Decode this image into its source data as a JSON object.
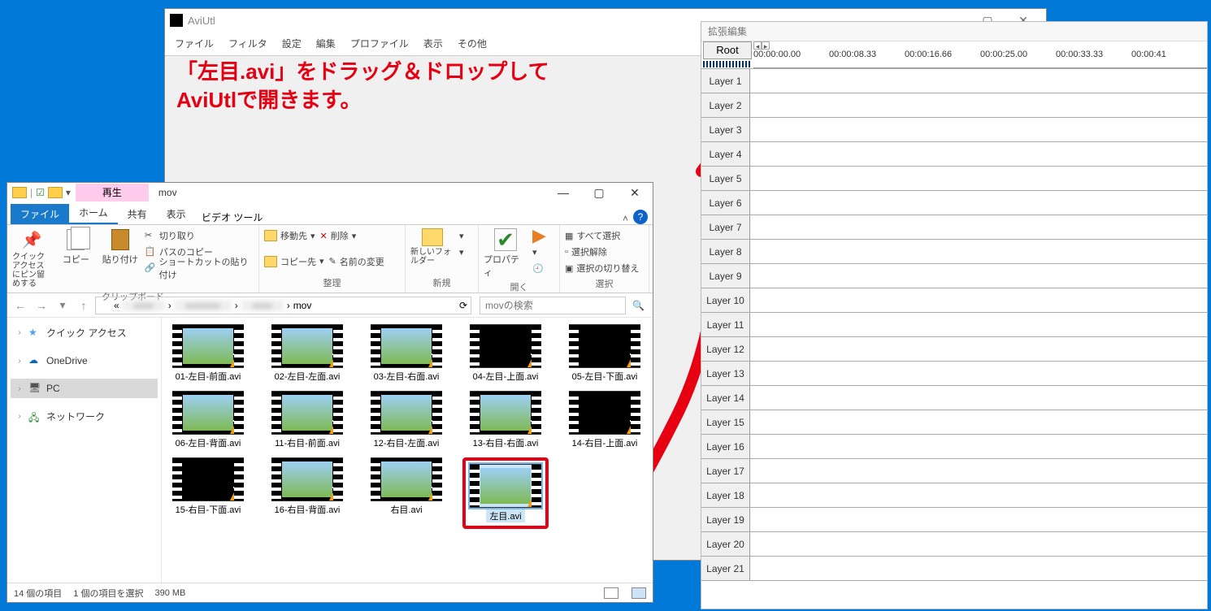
{
  "aviutl": {
    "title": "AviUtl",
    "menu": [
      "ファイル",
      "フィルタ",
      "設定",
      "編集",
      "プロファイル",
      "表示",
      "その他"
    ],
    "overlay_line1": "「左目.avi」をドラッグ＆ドロップして",
    "overlay_line2": "AviUtlで開きます。"
  },
  "ext_editor": {
    "title": "拡張編集",
    "root": "Root",
    "timecodes": [
      "00:00:00.00",
      "00:00:08.33",
      "00:00:16.66",
      "00:00:25.00",
      "00:00:33.33",
      "00:00:41"
    ],
    "layer_prefix": "Layer",
    "layer_count": 21
  },
  "explorer": {
    "context_tab": "再生",
    "window_title": "mov",
    "tabs": {
      "file": "ファイル",
      "home": "ホーム",
      "share": "共有",
      "view": "表示",
      "video_tool": "ビデオ ツール"
    },
    "ribbon": {
      "clipboard": {
        "pin": "クイック アクセスにピン留めする",
        "copy": "コピー",
        "paste": "貼り付け",
        "cut": "切り取り",
        "copy_path": "パスのコピー",
        "paste_shortcut": "ショートカットの貼り付け",
        "label": "クリップボード"
      },
      "organize": {
        "move": "移動先",
        "copy_to": "コピー先",
        "delete": "削除",
        "rename": "名前の変更",
        "label": "整理"
      },
      "new": {
        "new_folder": "新しいフォルダー",
        "label": "新規"
      },
      "open": {
        "properties": "プロパティ",
        "label": "開く"
      },
      "select": {
        "all": "すべて選択",
        "none": "選択解除",
        "invert": "選択の切り替え",
        "label": "選択"
      }
    },
    "path_last": "mov",
    "search_placeholder": "movの検索",
    "nav_items": {
      "quick": "クイック アクセス",
      "onedrive": "OneDrive",
      "pc": "PC",
      "network": "ネットワーク"
    },
    "files": [
      {
        "name": "01-左目-前面.avi",
        "dark": false
      },
      {
        "name": "02-左目-左面.avi",
        "dark": false
      },
      {
        "name": "03-左目-右面.avi",
        "dark": false
      },
      {
        "name": "04-左目-上面.avi",
        "dark": true
      },
      {
        "name": "05-左目-下面.avi",
        "dark": true
      },
      {
        "name": "06-左目-背面.avi",
        "dark": false
      },
      {
        "name": "11-右目-前面.avi",
        "dark": false
      },
      {
        "name": "12-右目-左面.avi",
        "dark": false
      },
      {
        "name": "13-右目-右面.avi",
        "dark": false
      },
      {
        "name": "14-右目-上面.avi",
        "dark": true
      },
      {
        "name": "15-右目-下面.avi",
        "dark": true
      },
      {
        "name": "16-右目-背面.avi",
        "dark": false
      },
      {
        "name": "右目.avi",
        "dark": false
      },
      {
        "name": "左目.avi",
        "dark": false,
        "selected": true,
        "highlight": true
      }
    ],
    "status": {
      "count": "14 個の項目",
      "selected": "1 個の項目を選択",
      "size": "390 MB"
    }
  }
}
